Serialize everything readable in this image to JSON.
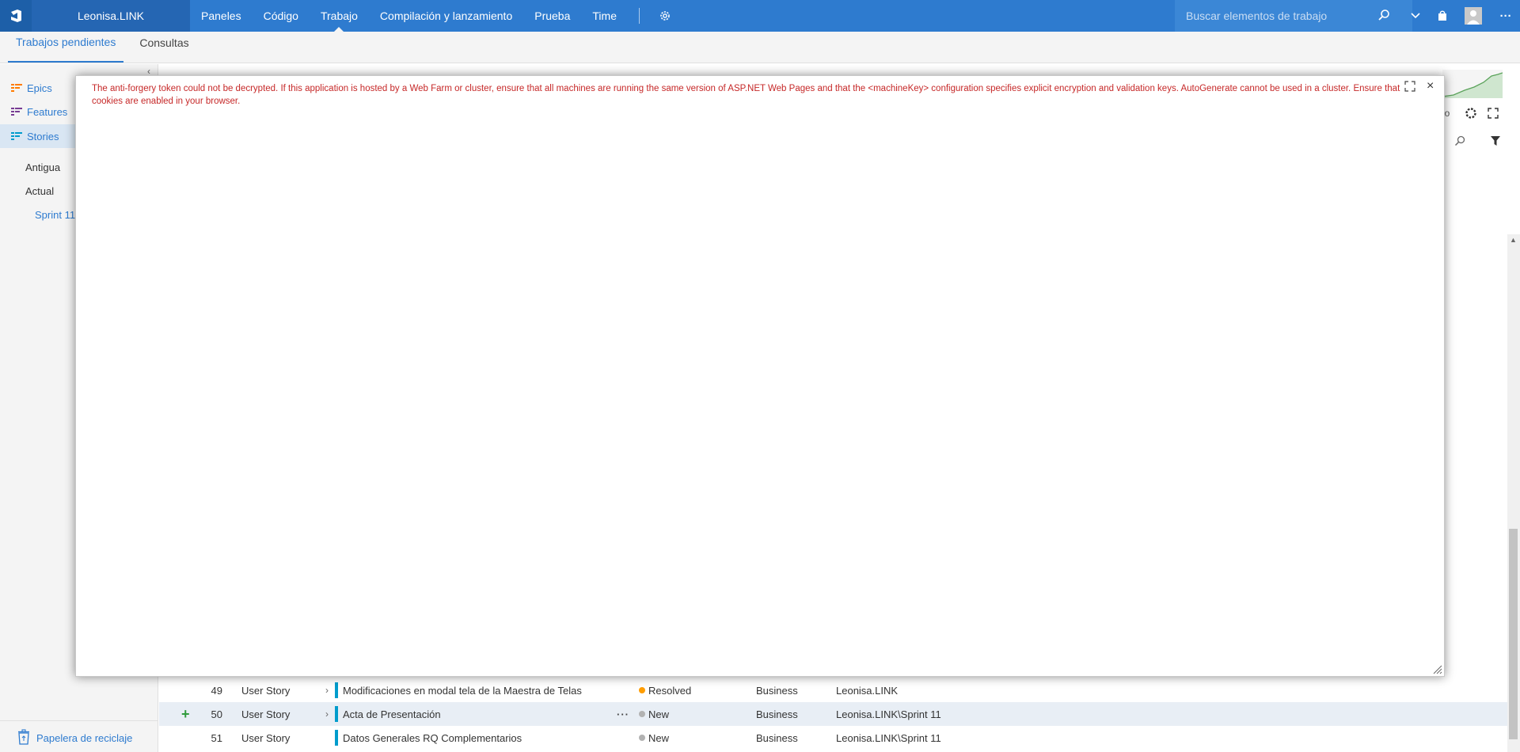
{
  "topbar": {
    "project": "Leonisa.LINK",
    "nav": [
      "Paneles",
      "Código",
      "Trabajo",
      "Compilación y lanzamiento",
      "Prueba",
      "Time"
    ],
    "active_nav": "Trabajo",
    "search_placeholder": "Buscar elementos de trabajo",
    "more_label": "···"
  },
  "subnav": {
    "tabs": [
      "Trabajos pendientes",
      "Consultas"
    ]
  },
  "leftpanel": {
    "collapse_glyph": "‹",
    "items": [
      "Epics",
      "Features",
      "Stories"
    ],
    "colors": {
      "epics": "#ff7b00",
      "features": "#773b93",
      "stories": "#009ccc"
    },
    "iterations": [
      "Antigua",
      "Actual"
    ],
    "sprint": "Sprint 11",
    "recycle_bin": "Papelera de reciclaje"
  },
  "toolbar": {
    "partial_label": "do"
  },
  "rows": [
    {
      "id": "49",
      "type": "User Story",
      "title": "Modificaciones en modal tela de la Maestra de Telas",
      "state": "Resolved",
      "state_color": "#ff9d00",
      "area": "Business",
      "iteration": "Leonisa.LINK"
    },
    {
      "id": "50",
      "type": "User Story",
      "title": "Acta de Presentación",
      "state": "New",
      "state_color": "#b2b2b2",
      "area": "Business",
      "iteration": "Leonisa.LINK\\Sprint 11"
    },
    {
      "id": "51",
      "type": "User Story",
      "title": "Datos Generales RQ Complementarios",
      "state": "New",
      "state_color": "#b2b2b2",
      "area": "Business",
      "iteration": "Leonisa.LINK\\Sprint 11"
    }
  ],
  "row_glyphs": {
    "expand": "›",
    "add": "+",
    "more": "···"
  },
  "modal": {
    "message": "The anti-forgery token could not be decrypted. If this application is hosted by a Web Farm or cluster, ensure that all machines are running the same version of ASP.NET Web Pages and that the <machineKey> configuration specifies explicit encryption and validation keys. AutoGenerate cannot be used in a cluster. Ensure that cookies are enabled in your browser.",
    "close_glyph": "×"
  }
}
